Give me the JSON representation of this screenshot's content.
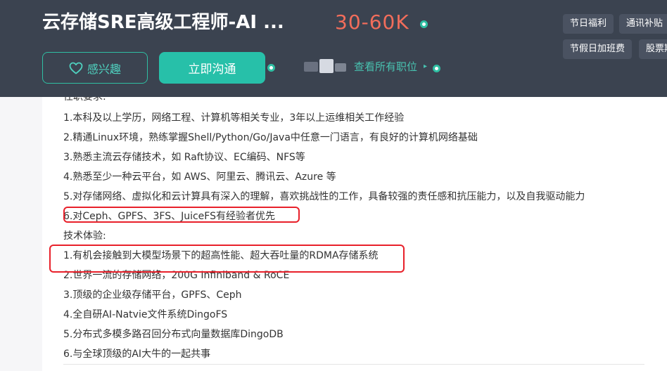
{
  "header": {
    "title": "云存储SRE高级工程师-AI ...",
    "salary": "30-60K",
    "tags": [
      "节日福利",
      "通讯补贴",
      "节假日加班费",
      "股票期权"
    ],
    "interest_label": "感兴趣",
    "chat_label": "立即沟通",
    "view_all_label": "查看所有职位"
  },
  "content": {
    "requirements_heading": "任职要求:",
    "requirements": [
      "1.本科及以上学历，网络工程、计算机等相关专业，3年以上运维相关工作经验",
      "2.精通Linux环境，熟练掌握Shell/Python/Go/Java中任意一门语言，有良好的计算机网络基础",
      "3.熟悉主流云存储技术，如 Raft协议、EC编码、NFS等",
      "4.熟悉至少一种云平台，如 AWS、阿里云、腾讯云、Azure 等",
      "5.对存储网络、虚拟化和云计算具有深入的理解，喜欢挑战性的工作，具备较强的责任感和抗压能力，以及自我驱动能力",
      "6.对Ceph、GPFS、3FS、JuiceFS有经验者优先"
    ],
    "tech_heading": "技术体验:",
    "tech": [
      "1.有机会接触到大模型场景下的超高性能、超大吞吐量的RDMA存储系统",
      "2.世界一流的存储网络，200G Infiniband & RoCE",
      "3.顶级的企业级存储平台，GPFS、Ceph",
      "4.全自研AI-Natvie文件系统DingoFS",
      "5.分布式多模多路召回分布式向量数据库DingoDB",
      "6.与全球顶级的AI大牛的一起共事"
    ]
  },
  "colors": {
    "header_bg": "#3b4350",
    "accent": "#27c0a9",
    "salary": "#f26d5b",
    "highlight": "#e8202a"
  },
  "icons": [
    "heart-icon",
    "chevron-right-icon"
  ]
}
